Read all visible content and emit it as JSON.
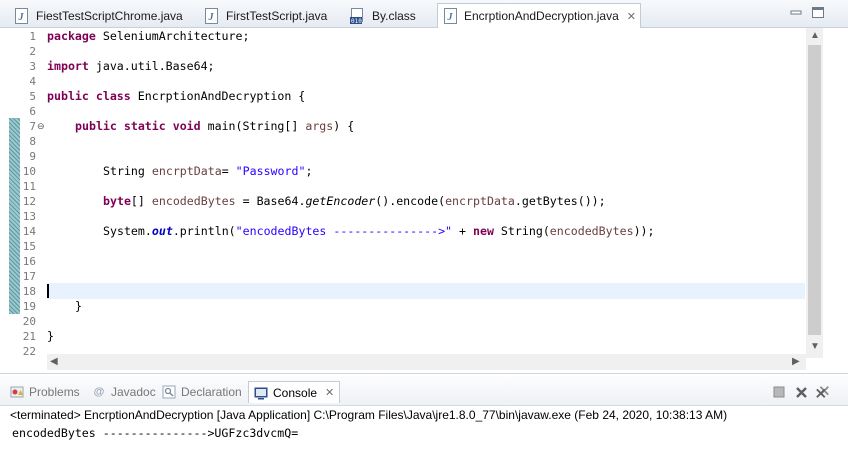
{
  "editor_tabs": [
    {
      "label": "FiestTestScriptChrome.java",
      "icon": "java-file-icon",
      "active": false
    },
    {
      "label": "FirstTestScript.java",
      "icon": "java-file-icon",
      "active": false
    },
    {
      "label": "By.class",
      "icon": "class-file-icon",
      "active": false
    },
    {
      "label": "EncrptionAndDecryption.java",
      "icon": "java-file-icon",
      "active": true
    }
  ],
  "tab_close_glyph": "✕",
  "line_numbers": [
    "1",
    "2",
    "3",
    "4",
    "5",
    "6",
    "7",
    "8",
    "9",
    "10",
    "11",
    "12",
    "13",
    "14",
    "15",
    "16",
    "17",
    "18",
    "19",
    "20",
    "21",
    "22"
  ],
  "fold_marker": "⊖",
  "code": {
    "l1_kw": "package",
    "l1_rest": " SeleniumArchitecture;",
    "l3_kw": "import",
    "l3_rest": " java.util.Base64;",
    "l5_kw1": "public",
    "l5_kw2": " class",
    "l5_rest": " EncrptionAndDecryption {",
    "l7_kw": "public static void",
    "l7_a": " main(String[] ",
    "l7_var": "args",
    "l7_b": ") {",
    "l10_a": "String ",
    "l10_var": "encrptData",
    "l10_b": "= ",
    "l10_str": "\"Password\"",
    "l10_c": ";",
    "l12_kw": "byte",
    "l12_a": "[] ",
    "l12_var": "encodedBytes",
    "l12_b": " = Base64.",
    "l12_it": "getEncoder",
    "l12_c": "().encode(",
    "l12_var2": "encrptData",
    "l12_d": ".getBytes());",
    "l14_a": "System.",
    "l14_st": "out",
    "l14_b": ".println(",
    "l14_str": "\"encodedBytes --------------->\"",
    "l14_c": " + ",
    "l14_kw": "new",
    "l14_d": " String(",
    "l14_var": "encodedBytes",
    "l14_e": "));",
    "l19": "}",
    "l21": "}"
  },
  "view_tabs": [
    {
      "label": "Problems",
      "icon": "problems-icon",
      "active": false
    },
    {
      "label": "Javadoc",
      "icon": "javadoc-icon",
      "active": false
    },
    {
      "label": "Declaration",
      "icon": "declaration-icon",
      "active": false
    },
    {
      "label": "Console",
      "icon": "console-icon",
      "active": true
    }
  ],
  "view_close_glyph": "✕",
  "console": {
    "terminated": "<terminated> EncrptionAndDecryption [Java Application] C:\\Program Files\\Java\\jre1.8.0_77\\bin\\javaw.exe (Feb 24, 2020, 10:38:13 AM)",
    "output": "encodedBytes --------------->UGFzc3dvcmQ="
  },
  "colors": {
    "keyword": "#7f0055",
    "string": "#2a00ff",
    "variable": "#6a3e3e",
    "static_field": "#0000c0",
    "current_line": "#e8f2fe"
  }
}
